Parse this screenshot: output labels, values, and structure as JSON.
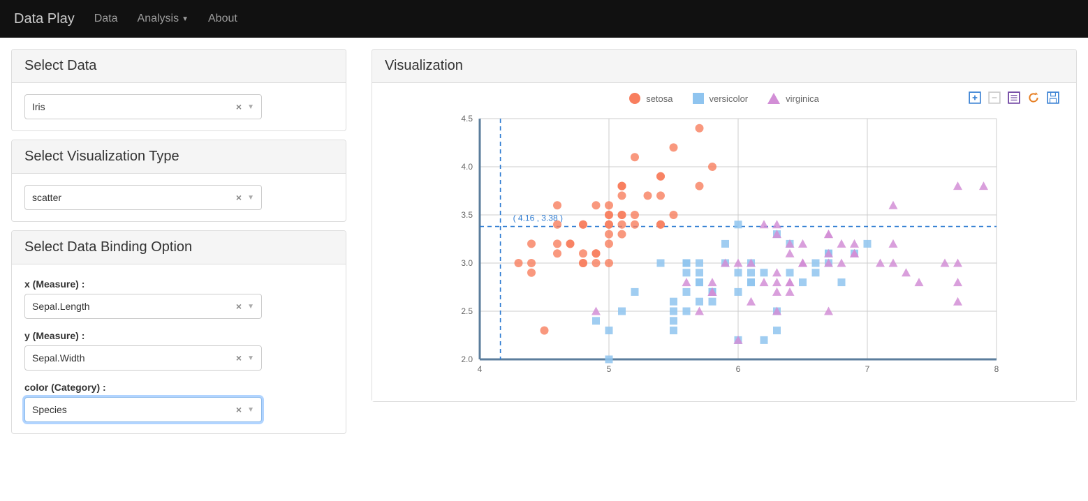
{
  "navbar": {
    "brand": "Data Play",
    "items": [
      "Data",
      "Analysis",
      "About"
    ],
    "analysis_has_dropdown": true
  },
  "panels": {
    "select_data": {
      "title": "Select Data",
      "value": "Iris"
    },
    "vis_type": {
      "title": "Select Visualization Type",
      "value": "scatter"
    },
    "binding": {
      "title": "Select Data Binding Option",
      "x": {
        "label": "x (Measure) :",
        "value": "Sepal.Length"
      },
      "y": {
        "label": "y (Measure) :",
        "value": "Sepal.Width"
      },
      "color": {
        "label": "color (Category) :",
        "value": "Species"
      }
    },
    "visualization": {
      "title": "Visualization"
    }
  },
  "toolbar_icons": [
    "zoom-in-icon",
    "zoom-out-icon",
    "lines-icon",
    "refresh-icon",
    "save-icon"
  ],
  "chart_data": {
    "type": "scatter",
    "xlabel": "",
    "ylabel": "",
    "xlim": [
      4,
      8
    ],
    "ylim": [
      2,
      4.5
    ],
    "xticks": [
      4,
      5,
      6,
      7,
      8
    ],
    "yticks": [
      2.0,
      2.5,
      3.0,
      3.5,
      4.0,
      4.5
    ],
    "crosshair": {
      "x": 4.16,
      "y": 3.38,
      "label": "( 4.16 , 3.38 )"
    },
    "legend": [
      "setosa",
      "versicolor",
      "virginica"
    ],
    "colors": {
      "setosa": "#f87e5e",
      "versicolor": "#8fc4ef",
      "virginica": "#d28ed6"
    },
    "series": [
      {
        "name": "setosa",
        "marker": "circle",
        "points": [
          [
            4.3,
            3.0
          ],
          [
            4.4,
            2.9
          ],
          [
            4.4,
            3.0
          ],
          [
            4.4,
            3.2
          ],
          [
            4.5,
            2.3
          ],
          [
            4.6,
            3.1
          ],
          [
            4.6,
            3.2
          ],
          [
            4.6,
            3.4
          ],
          [
            4.6,
            3.6
          ],
          [
            4.7,
            3.2
          ],
          [
            4.7,
            3.2
          ],
          [
            4.8,
            3.0
          ],
          [
            4.8,
            3.0
          ],
          [
            4.8,
            3.1
          ],
          [
            4.8,
            3.4
          ],
          [
            4.8,
            3.4
          ],
          [
            4.9,
            3.0
          ],
          [
            4.9,
            3.1
          ],
          [
            4.9,
            3.1
          ],
          [
            4.9,
            3.6
          ],
          [
            5.0,
            3.0
          ],
          [
            5.0,
            3.2
          ],
          [
            5.0,
            3.3
          ],
          [
            5.0,
            3.4
          ],
          [
            5.0,
            3.4
          ],
          [
            5.0,
            3.5
          ],
          [
            5.0,
            3.5
          ],
          [
            5.0,
            3.6
          ],
          [
            5.1,
            3.3
          ],
          [
            5.1,
            3.4
          ],
          [
            5.1,
            3.5
          ],
          [
            5.1,
            3.5
          ],
          [
            5.1,
            3.7
          ],
          [
            5.1,
            3.8
          ],
          [
            5.1,
            3.8
          ],
          [
            5.1,
            3.8
          ],
          [
            5.2,
            3.4
          ],
          [
            5.2,
            3.5
          ],
          [
            5.2,
            4.1
          ],
          [
            5.3,
            3.7
          ],
          [
            5.4,
            3.4
          ],
          [
            5.4,
            3.4
          ],
          [
            5.4,
            3.7
          ],
          [
            5.4,
            3.9
          ],
          [
            5.4,
            3.9
          ],
          [
            5.5,
            3.5
          ],
          [
            5.5,
            4.2
          ],
          [
            5.7,
            3.8
          ],
          [
            5.7,
            4.4
          ],
          [
            5.8,
            4.0
          ]
        ]
      },
      {
        "name": "versicolor",
        "marker": "square",
        "points": [
          [
            4.9,
            2.4
          ],
          [
            5.0,
            2.0
          ],
          [
            5.0,
            2.3
          ],
          [
            5.1,
            2.5
          ],
          [
            5.2,
            2.7
          ],
          [
            5.4,
            3.0
          ],
          [
            5.5,
            2.3
          ],
          [
            5.5,
            2.4
          ],
          [
            5.5,
            2.5
          ],
          [
            5.5,
            2.6
          ],
          [
            5.6,
            2.5
          ],
          [
            5.6,
            2.7
          ],
          [
            5.6,
            2.9
          ],
          [
            5.6,
            3.0
          ],
          [
            5.6,
            3.0
          ],
          [
            5.7,
            2.6
          ],
          [
            5.7,
            2.8
          ],
          [
            5.7,
            2.8
          ],
          [
            5.7,
            2.9
          ],
          [
            5.7,
            3.0
          ],
          [
            5.8,
            2.6
          ],
          [
            5.8,
            2.7
          ],
          [
            5.8,
            2.7
          ],
          [
            5.9,
            3.0
          ],
          [
            5.9,
            3.2
          ],
          [
            6.0,
            2.2
          ],
          [
            6.0,
            2.7
          ],
          [
            6.0,
            2.9
          ],
          [
            6.0,
            3.4
          ],
          [
            6.1,
            2.8
          ],
          [
            6.1,
            2.8
          ],
          [
            6.1,
            2.9
          ],
          [
            6.1,
            3.0
          ],
          [
            6.2,
            2.2
          ],
          [
            6.2,
            2.9
          ],
          [
            6.3,
            2.3
          ],
          [
            6.3,
            2.5
          ],
          [
            6.3,
            3.3
          ],
          [
            6.4,
            2.9
          ],
          [
            6.4,
            3.2
          ],
          [
            6.5,
            2.8
          ],
          [
            6.6,
            2.9
          ],
          [
            6.6,
            3.0
          ],
          [
            6.7,
            3.0
          ],
          [
            6.7,
            3.1
          ],
          [
            6.7,
            3.1
          ],
          [
            6.8,
            2.8
          ],
          [
            6.9,
            3.1
          ],
          [
            7.0,
            3.2
          ]
        ]
      },
      {
        "name": "virginica",
        "marker": "triangle",
        "points": [
          [
            4.9,
            2.5
          ],
          [
            5.6,
            2.8
          ],
          [
            5.7,
            2.5
          ],
          [
            5.8,
            2.7
          ],
          [
            5.8,
            2.7
          ],
          [
            5.8,
            2.8
          ],
          [
            5.9,
            3.0
          ],
          [
            6.0,
            2.2
          ],
          [
            6.0,
            3.0
          ],
          [
            6.1,
            2.6
          ],
          [
            6.1,
            3.0
          ],
          [
            6.2,
            2.8
          ],
          [
            6.2,
            3.4
          ],
          [
            6.3,
            2.5
          ],
          [
            6.3,
            2.7
          ],
          [
            6.3,
            2.8
          ],
          [
            6.3,
            2.9
          ],
          [
            6.3,
            3.3
          ],
          [
            6.3,
            3.4
          ],
          [
            6.4,
            2.7
          ],
          [
            6.4,
            2.8
          ],
          [
            6.4,
            2.8
          ],
          [
            6.4,
            3.1
          ],
          [
            6.4,
            3.2
          ],
          [
            6.5,
            3.0
          ],
          [
            6.5,
            3.0
          ],
          [
            6.5,
            3.0
          ],
          [
            6.5,
            3.2
          ],
          [
            6.7,
            2.5
          ],
          [
            6.7,
            3.0
          ],
          [
            6.7,
            3.1
          ],
          [
            6.7,
            3.3
          ],
          [
            6.7,
            3.3
          ],
          [
            6.8,
            3.0
          ],
          [
            6.8,
            3.2
          ],
          [
            6.9,
            3.1
          ],
          [
            6.9,
            3.1
          ],
          [
            6.9,
            3.2
          ],
          [
            7.1,
            3.0
          ],
          [
            7.2,
            3.0
          ],
          [
            7.2,
            3.2
          ],
          [
            7.2,
            3.6
          ],
          [
            7.3,
            2.9
          ],
          [
            7.4,
            2.8
          ],
          [
            7.6,
            3.0
          ],
          [
            7.7,
            2.6
          ],
          [
            7.7,
            2.8
          ],
          [
            7.7,
            3.0
          ],
          [
            7.7,
            3.8
          ],
          [
            7.9,
            3.8
          ]
        ]
      }
    ]
  }
}
